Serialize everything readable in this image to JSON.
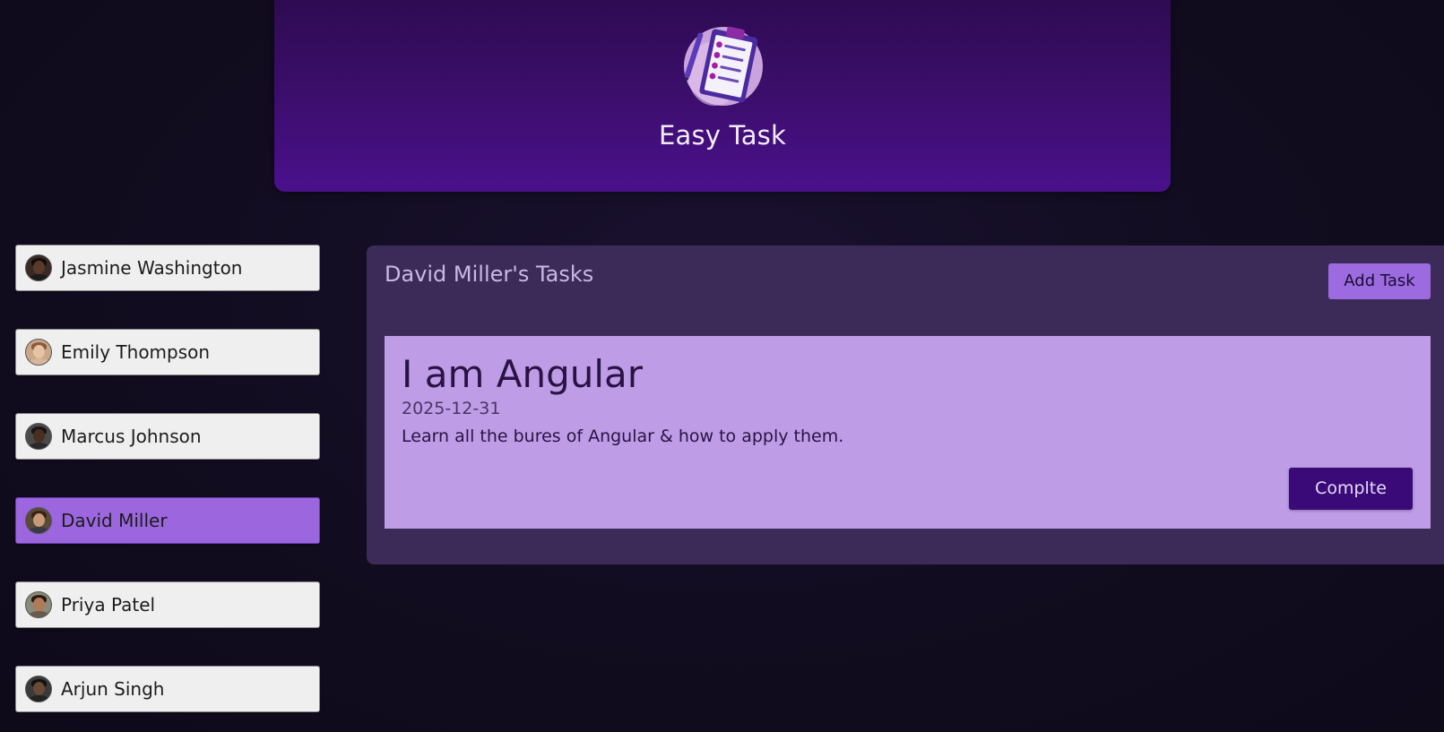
{
  "header": {
    "app_title": "Easy Task",
    "logo_icon": "clipboard-checklist-icon"
  },
  "users": [
    {
      "name": "Jasmine Washington",
      "selected": false
    },
    {
      "name": "Emily Thompson",
      "selected": false
    },
    {
      "name": "Marcus Johnson",
      "selected": false
    },
    {
      "name": "David Miller",
      "selected": true
    },
    {
      "name": "Priya Patel",
      "selected": false
    },
    {
      "name": "Arjun Singh",
      "selected": false
    }
  ],
  "tasks_panel": {
    "title": "David Miller's Tasks",
    "add_task_label": "Add Task"
  },
  "task": {
    "title": "I am Angular",
    "due_date": "2025-12-31",
    "description": "Learn all the bures of Angular & how to apply them.",
    "complete_label": "Complte"
  },
  "colors": {
    "background": "#110c1f",
    "header": "#3c0e6c",
    "selected_user": "#9b66de",
    "panel": "#3c2b58",
    "task_card": "#be9de6",
    "complete_button": "#3a0a78"
  }
}
